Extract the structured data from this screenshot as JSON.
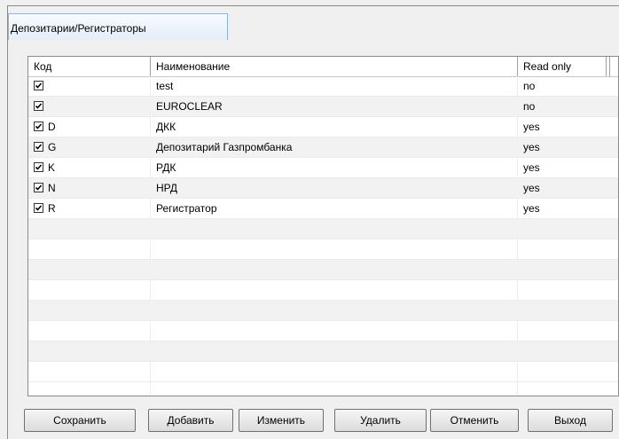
{
  "tab": {
    "title": "Депозитарии/Регистраторы"
  },
  "table": {
    "columns": [
      "Код",
      "Наименование",
      "Read only"
    ],
    "rows": [
      {
        "checked": true,
        "code": "",
        "name": "test",
        "read_only": "no"
      },
      {
        "checked": true,
        "code": "",
        "name": "EUROCLEAR",
        "read_only": "no"
      },
      {
        "checked": true,
        "code": "D",
        "name": "ДКК",
        "read_only": "yes"
      },
      {
        "checked": true,
        "code": "G",
        "name": "Депозитарий Газпромбанка",
        "read_only": "yes"
      },
      {
        "checked": true,
        "code": "K",
        "name": "РДК",
        "read_only": "yes"
      },
      {
        "checked": true,
        "code": "N",
        "name": "НРД",
        "read_only": "yes"
      },
      {
        "checked": true,
        "code": "R",
        "name": "Регистратор",
        "read_only": "yes"
      }
    ]
  },
  "buttons": {
    "save": "Сохранить",
    "add": "Добавить",
    "edit": "Изменить",
    "delete": "Удалить",
    "cancel": "Отменить",
    "exit": "Выход"
  }
}
